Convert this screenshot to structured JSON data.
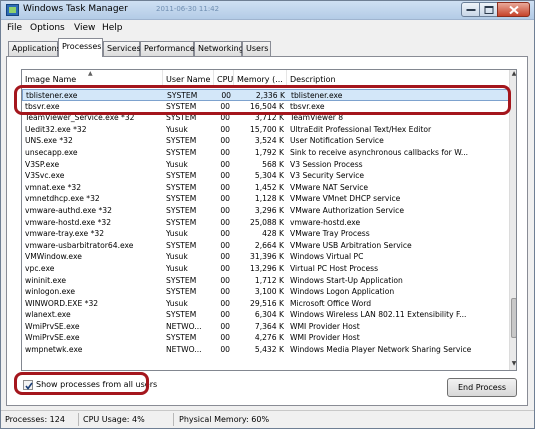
{
  "window": {
    "title": "Windows Task Manager",
    "title_background_text": "2011-06-30 11:42",
    "menu": [
      "File",
      "Options",
      "View",
      "Help"
    ],
    "tabs": [
      "Applications",
      "Processes",
      "Services",
      "Performance",
      "Networking",
      "Users"
    ],
    "active_tab": "Processes"
  },
  "columns": [
    "Image Name",
    "User Name",
    "CPU",
    "Memory (...",
    "Description"
  ],
  "rows": [
    {
      "image": "tblistener.exe",
      "user": "SYSTEM",
      "cpu": "00",
      "mem": "2,336 K",
      "desc": "tblistener.exe",
      "selected": true
    },
    {
      "image": "tbsvr.exe",
      "user": "SYSTEM",
      "cpu": "00",
      "mem": "16,504 K",
      "desc": "tbsvr.exe"
    },
    {
      "image": "TeamViewer_Service.exe *32",
      "user": "SYSTEM",
      "cpu": "00",
      "mem": "3,712 K",
      "desc": "TeamViewer 8"
    },
    {
      "image": "Uedit32.exe *32",
      "user": "Yusuk",
      "cpu": "00",
      "mem": "15,700 K",
      "desc": "UltraEdit Professional Text/Hex Editor"
    },
    {
      "image": "UNS.exe *32",
      "user": "SYSTEM",
      "cpu": "00",
      "mem": "3,524 K",
      "desc": "User Notification Service"
    },
    {
      "image": "unsecapp.exe",
      "user": "SYSTEM",
      "cpu": "00",
      "mem": "1,792 K",
      "desc": "Sink to receive asynchronous callbacks for W..."
    },
    {
      "image": "V3SP.exe",
      "user": "Yusuk",
      "cpu": "00",
      "mem": "568 K",
      "desc": "V3 Session Process"
    },
    {
      "image": "V3Svc.exe",
      "user": "SYSTEM",
      "cpu": "00",
      "mem": "5,304 K",
      "desc": "V3 Security Service"
    },
    {
      "image": "vmnat.exe *32",
      "user": "SYSTEM",
      "cpu": "00",
      "mem": "1,452 K",
      "desc": "VMware NAT Service"
    },
    {
      "image": "vmnetdhcp.exe *32",
      "user": "SYSTEM",
      "cpu": "00",
      "mem": "1,128 K",
      "desc": "VMware VMnet DHCP service"
    },
    {
      "image": "vmware-authd.exe *32",
      "user": "SYSTEM",
      "cpu": "00",
      "mem": "3,296 K",
      "desc": "VMware Authorization Service"
    },
    {
      "image": "vmware-hostd.exe *32",
      "user": "SYSTEM",
      "cpu": "00",
      "mem": "25,088 K",
      "desc": "vmware-hostd.exe"
    },
    {
      "image": "vmware-tray.exe *32",
      "user": "Yusuk",
      "cpu": "00",
      "mem": "428 K",
      "desc": "VMware Tray Process"
    },
    {
      "image": "vmware-usbarbitrator64.exe",
      "user": "SYSTEM",
      "cpu": "00",
      "mem": "2,664 K",
      "desc": "VMware USB Arbitration Service"
    },
    {
      "image": "VMWindow.exe",
      "user": "Yusuk",
      "cpu": "00",
      "mem": "31,396 K",
      "desc": "Windows Virtual PC"
    },
    {
      "image": "vpc.exe",
      "user": "Yusuk",
      "cpu": "00",
      "mem": "13,296 K",
      "desc": "Virtual PC Host Process"
    },
    {
      "image": "wininit.exe",
      "user": "SYSTEM",
      "cpu": "00",
      "mem": "1,712 K",
      "desc": "Windows Start-Up Application"
    },
    {
      "image": "winlogon.exe",
      "user": "SYSTEM",
      "cpu": "00",
      "mem": "3,100 K",
      "desc": "Windows Logon Application"
    },
    {
      "image": "WINWORD.EXE *32",
      "user": "Yusuk",
      "cpu": "00",
      "mem": "29,516 K",
      "desc": "Microsoft Office Word"
    },
    {
      "image": "wlanext.exe",
      "user": "SYSTEM",
      "cpu": "00",
      "mem": "6,304 K",
      "desc": "Windows Wireless LAN 802.11 Extensibility F..."
    },
    {
      "image": "WmiPrvSE.exe",
      "user": "NETWO...",
      "cpu": "00",
      "mem": "7,364 K",
      "desc": "WMI Provider Host"
    },
    {
      "image": "WmiPrvSE.exe",
      "user": "SYSTEM",
      "cpu": "00",
      "mem": "4,276 K",
      "desc": "WMI Provider Host"
    },
    {
      "image": "wmpnetwk.exe",
      "user": "NETWO...",
      "cpu": "00",
      "mem": "5,432 K",
      "desc": "Windows Media Player Network Sharing Service"
    }
  ],
  "show_all_label": "Show processes from all users",
  "show_all_checked": true,
  "end_process_label": "End Process",
  "status": {
    "processes": "Processes: 124",
    "cpu": "CPU Usage: 4%",
    "memory": "Physical Memory: 60%"
  },
  "colors": {
    "highlight": "#a4161d",
    "selection": "#d3e7f9"
  }
}
